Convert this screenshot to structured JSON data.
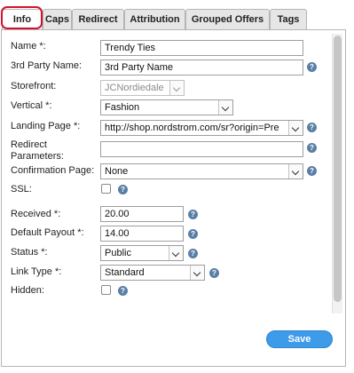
{
  "tabs": [
    {
      "label": "Info"
    },
    {
      "label": "Caps"
    },
    {
      "label": "Redirect"
    },
    {
      "label": "Attribution"
    },
    {
      "label": "Grouped Offers"
    },
    {
      "label": "Tags"
    }
  ],
  "form": {
    "name": {
      "label": "Name *:",
      "value": "Trendy Ties"
    },
    "third_party_name": {
      "label": "3rd Party Name:",
      "value": "3rd Party Name"
    },
    "storefront": {
      "label": "Storefront:",
      "value": "JCNordiedale"
    },
    "vertical": {
      "label": "Vertical *:",
      "value": "Fashion"
    },
    "landing_page": {
      "label": "Landing Page *:",
      "value": "http://shop.nordstrom.com/sr?origin=Pre"
    },
    "redirect_parameters": {
      "label_line1": "Redirect",
      "label_line2": "Parameters:",
      "value": ""
    },
    "confirmation_page": {
      "label": "Confirmation Page:",
      "value": "None"
    },
    "ssl": {
      "label": "SSL:"
    },
    "received": {
      "label": "Received *:",
      "value": "20.00"
    },
    "default_payout": {
      "label": "Default Payout *:",
      "value": "14.00"
    },
    "status": {
      "label": "Status *:",
      "value": "Public"
    },
    "link_type": {
      "label": "Link Type *:",
      "value": "Standard"
    },
    "hidden": {
      "label": "Hidden:"
    }
  },
  "help_glyph": "?",
  "save_label": "Save",
  "colors": {
    "accent": "#3d9be9",
    "highlight": "#d3132d",
    "help_icon": "#5a7fa6"
  }
}
